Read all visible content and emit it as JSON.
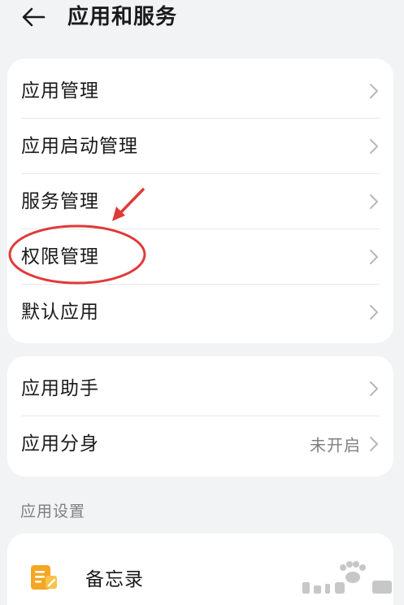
{
  "header": {
    "title": "应用和服务"
  },
  "group1": {
    "items": [
      {
        "label": "应用管理"
      },
      {
        "label": "应用启动管理"
      },
      {
        "label": "服务管理"
      },
      {
        "label": "权限管理"
      },
      {
        "label": "默认应用"
      }
    ]
  },
  "group2": {
    "items": [
      {
        "label": "应用助手"
      },
      {
        "label": "应用分身",
        "value": "未开启"
      }
    ]
  },
  "settings": {
    "section_label": "应用设置",
    "items": [
      {
        "label": "备忘录",
        "icon": "notes-app-icon"
      }
    ]
  },
  "colors": {
    "background": "#f1f3f5",
    "card": "#ffffff",
    "annotation": "#e03a3a",
    "notes_icon": "#f5a623"
  }
}
